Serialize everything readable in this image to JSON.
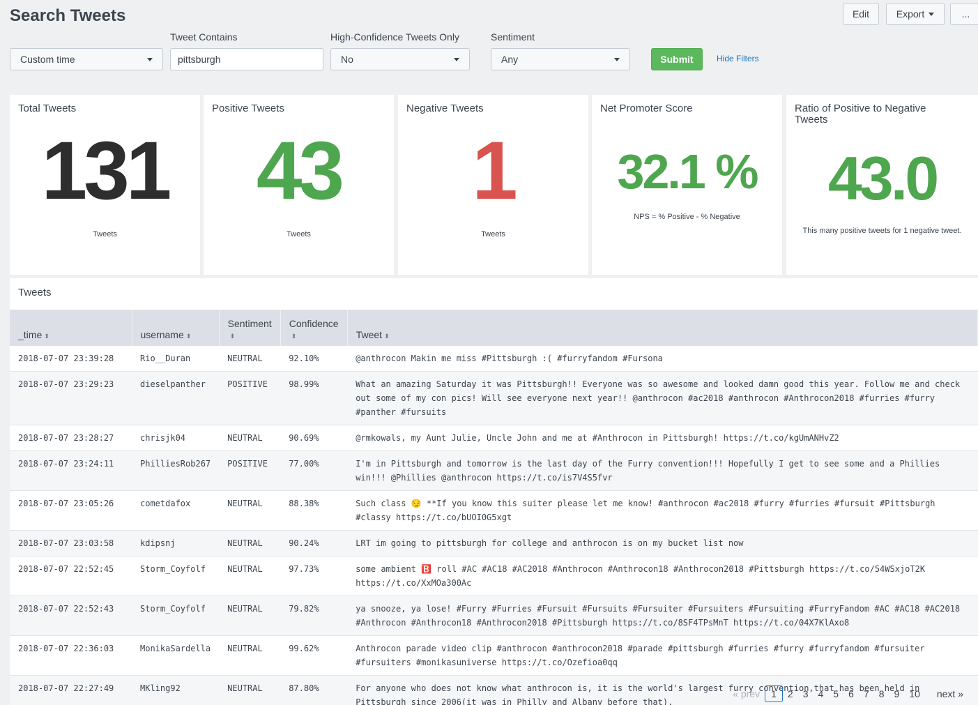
{
  "page": {
    "title": "Search Tweets"
  },
  "toolbar": {
    "edit_label": "Edit",
    "export_label": "Export",
    "more_label": "..."
  },
  "filters": {
    "time": {
      "value": "Custom time"
    },
    "tweet_contains": {
      "label": "Tweet Contains",
      "value": "pittsburgh"
    },
    "high_conf": {
      "label": "High-Confidence Tweets Only",
      "value": "No"
    },
    "sentiment": {
      "label": "Sentiment",
      "value": "Any"
    },
    "submit_label": "Submit",
    "hide_filters_label": "Hide Filters"
  },
  "stats": {
    "total": {
      "title": "Total Tweets",
      "value": "131",
      "caption": "Tweets",
      "color": "#2e2e2e"
    },
    "positive": {
      "title": "Positive Tweets",
      "value": "43",
      "caption": "Tweets",
      "color": "#4ea64e"
    },
    "negative": {
      "title": "Negative Tweets",
      "value": "1",
      "caption": "Tweets",
      "color": "#d9534f"
    },
    "nps": {
      "title": "Net Promoter Score",
      "value": "32.1 %",
      "caption": "NPS = % Positive - % Negative",
      "color": "#4ea64e"
    },
    "ratio": {
      "title": "Ratio of Positive to Negative Tweets",
      "value": "43.0",
      "caption": "This many positive tweets for 1 negative tweet.",
      "color": "#4ea64e"
    }
  },
  "tweets_table": {
    "title": "Tweets",
    "columns": [
      "_time",
      "username",
      "Sentiment",
      "Confidence",
      "Tweet"
    ],
    "rows": [
      [
        "2018-07-07 23:39:28",
        "Rio__Duran",
        "NEUTRAL",
        "92.10%",
        "@anthrocon Makin me miss #Pittsburgh :( #furryfandom #Fursona"
      ],
      [
        "2018-07-07 23:29:23",
        "dieselpanther",
        "POSITIVE",
        "98.99%",
        "What an amazing Saturday it was Pittsburgh!! Everyone was so awesome and looked damn good this year. Follow me and check out some of my con pics! Will see everyone next year!! @anthrocon #ac2018 #anthrocon #Anthrocon2018 #furries #furry #panther #fursuits"
      ],
      [
        "2018-07-07 23:28:27",
        "chrisjk04",
        "NEUTRAL",
        "90.69%",
        "@rmkowals, my Aunt Julie, Uncle John and me at #Anthrocon in Pittsburgh! https://t.co/kgUmANHvZ2"
      ],
      [
        "2018-07-07 23:24:11",
        "PhilliesRob267",
        "POSITIVE",
        "77.00%",
        "I'm in Pittsburgh and tomorrow is the last day of the Furry convention!!! Hopefully I get to see some and a Phillies win!!! @Phillies @anthrocon https://t.co/is7V4S5fvr"
      ],
      [
        "2018-07-07 23:05:26",
        "cometdafox",
        "NEUTRAL",
        "88.38%",
        "Such class 😏 **If you know this suiter please let me know! #anthrocon #ac2018 #furry #furries #fursuit #Pittsburgh #classy https://t.co/bUOI0G5xgt"
      ],
      [
        "2018-07-07 23:03:58",
        "kdipsnj",
        "NEUTRAL",
        "90.24%",
        "LRT im going to pittsburgh for college and anthrocon is on my bucket list now"
      ],
      [
        "2018-07-07 22:52:45",
        "Storm_Coyfolf",
        "NEUTRAL",
        "97.73%",
        "some ambient 🅱️ roll #AC #AC18 #AC2018 #Anthrocon #Anthrocon18 #Anthrocon2018 #Pittsburgh https://t.co/54WSxjoT2K https://t.co/XxMOa300Ac"
      ],
      [
        "2018-07-07 22:52:43",
        "Storm_Coyfolf",
        "NEUTRAL",
        "79.82%",
        "ya snooze, ya lose! #Furry #Furries #Fursuit #Fursuits #Fursuiter #Fursuiters #Fursuiting #FurryFandom #AC #AC18 #AC2018 #Anthrocon #Anthrocon18 #Anthrocon2018 #Pittsburgh https://t.co/8SF4TPsMnT https://t.co/04X7KlAxo8"
      ],
      [
        "2018-07-07 22:36:03",
        "MonikaSardella",
        "NEUTRAL",
        "99.62%",
        "Anthrocon parade video clip #anthrocon #anthrocon2018 #parade #pittsburgh #furries #furry #furryfandom #fursuiter #fursuiters #monikasuniverse https://t.co/Ozefioa0qq"
      ],
      [
        "2018-07-07 22:27:49",
        "MKling92",
        "NEUTRAL",
        "87.80%",
        "For anyone who does not know what anthrocon is, it is the world's largest furry convention,that has been held in Pittsburgh since 2006(it was in Philly and Albany before that)."
      ]
    ]
  },
  "pagination": {
    "prev_label": "« prev",
    "pages": [
      "1",
      "2",
      "3",
      "4",
      "5",
      "6",
      "7",
      "8",
      "9",
      "10"
    ],
    "current": "1",
    "next_label": "next »"
  }
}
